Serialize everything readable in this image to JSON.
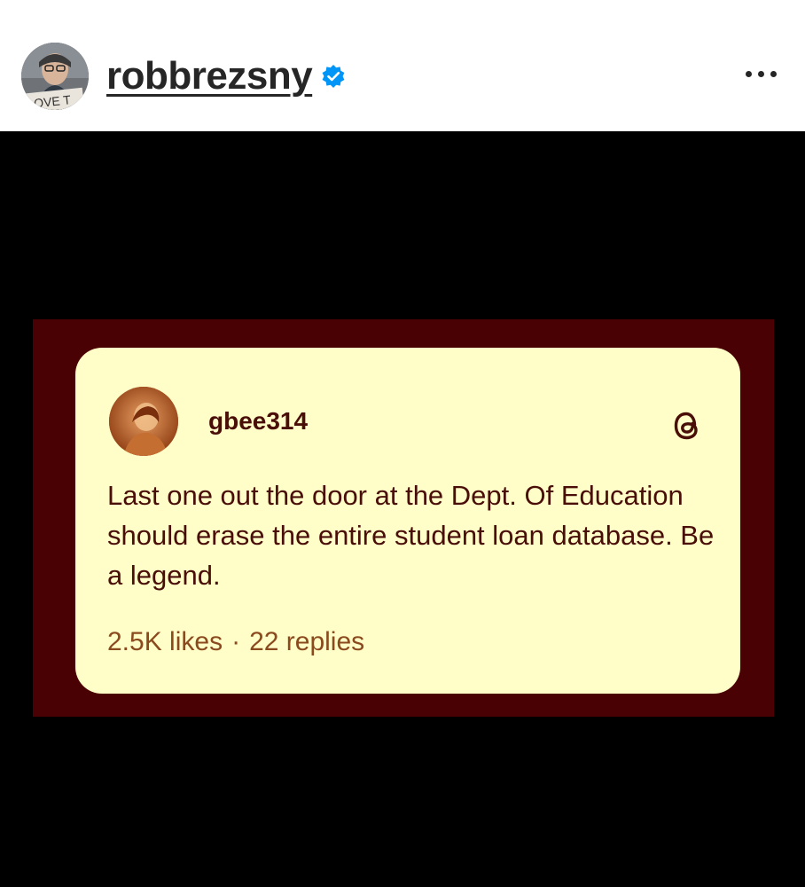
{
  "header": {
    "username": "robbrezsny",
    "avatar_sign_text": "OVE T",
    "verified_icon": "verified-badge-icon",
    "more_icon": "more-options-icon"
  },
  "post": {
    "author": "gbee314",
    "platform_icon": "threads-logo-icon",
    "text": "Last one out the door at the Dept. Of Education should erase the entire student loan database. Be a legend.",
    "likes": "2.5K likes",
    "separator": "·",
    "replies": "22 replies"
  },
  "colors": {
    "verified_blue": "#0095f6",
    "frame_maroon": "#4a0103",
    "card_cream": "#fffdc8",
    "card_text": "#4a0e08",
    "stats_text": "#8a4a1e"
  }
}
